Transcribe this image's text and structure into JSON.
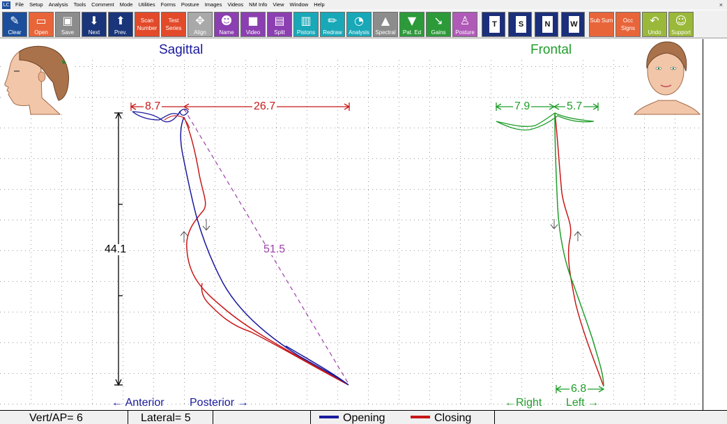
{
  "menu": {
    "items": [
      "File",
      "Setup",
      "Analysis",
      "Tools",
      "Comment",
      "Mode",
      "Utilities",
      "Forms",
      "Posture",
      "Images",
      "Videos",
      "NM Info",
      "View",
      "Window",
      "Help"
    ],
    "app_icon": "LC",
    "close_glyph": "×"
  },
  "toolbar": {
    "buttons": [
      {
        "label": "Clear",
        "icon": "clear-icon",
        "glyph": "✎",
        "color": "#1b4f9c"
      },
      {
        "label": "Open",
        "icon": "folder-icon",
        "glyph": "▭",
        "color": "#e8653a"
      },
      {
        "label": "Save",
        "icon": "save-icon",
        "glyph": "▣",
        "color": "#8c8c8c"
      },
      {
        "label": "Next",
        "icon": "arrow-down-icon",
        "glyph": "⬇",
        "color": "#1a3579"
      },
      {
        "label": "Prev.",
        "icon": "arrow-up-icon",
        "glyph": "⬆",
        "color": "#1a3579"
      },
      {
        "label": "Scan Number",
        "icon": "",
        "glyph": "",
        "color": "#e24a2a"
      },
      {
        "label": "Test Series",
        "icon": "",
        "glyph": "",
        "color": "#e24a2a"
      },
      {
        "label": "Align",
        "icon": "align-icon",
        "glyph": "✥",
        "color": "#a9a9a9"
      },
      {
        "label": "Name",
        "icon": "people-icon",
        "glyph": "☻",
        "color": "#8b3fb0"
      },
      {
        "label": "Video",
        "icon": "camera-icon",
        "glyph": "■",
        "color": "#8b3fb0"
      },
      {
        "label": "Split",
        "icon": "split-icon",
        "glyph": "▤",
        "color": "#8b3fb0"
      },
      {
        "label": "Pistons",
        "icon": "bars-icon",
        "glyph": "▥",
        "color": "#18a8b8"
      },
      {
        "label": "Redraw",
        "icon": "pencil-icon",
        "glyph": "✏",
        "color": "#18a8b8"
      },
      {
        "label": "Analysis",
        "icon": "chart-icon",
        "glyph": "◔",
        "color": "#18a8b8"
      },
      {
        "label": "Spectral",
        "icon": "spectrum-icon",
        "glyph": "▲",
        "color": "#8c8c8c"
      },
      {
        "label": "Pat. Ed",
        "icon": "graduation-cap-icon",
        "glyph": "▼",
        "color": "#2d9a3a"
      },
      {
        "label": "Gains",
        "icon": "gains-icon",
        "glyph": "↘",
        "color": "#2d9a3a"
      },
      {
        "label": "Posture",
        "icon": "person-icon",
        "glyph": "♙",
        "color": "#b05ab8"
      }
    ],
    "doc_buttons": [
      {
        "letter": "T",
        "icon": "document-t-icon"
      },
      {
        "letter": "S",
        "icon": "document-s-icon"
      },
      {
        "letter": "N",
        "icon": "document-n-icon"
      },
      {
        "letter": "W",
        "icon": "document-w-icon"
      }
    ],
    "right_buttons": [
      {
        "label": "Sub Sum",
        "icon": "",
        "glyph": "",
        "color": "#e8653a"
      },
      {
        "label": "Occ Signs",
        "icon": "",
        "glyph": "",
        "color": "#e8653a"
      },
      {
        "label": "Undo",
        "icon": "undo-icon",
        "glyph": "↶",
        "color": "#9ab83a"
      },
      {
        "label": "Support",
        "icon": "support-person-icon",
        "glyph": "☺",
        "color": "#9ab83a"
      }
    ]
  },
  "sagittal": {
    "title": "Sagittal",
    "anterior_dim": "8.7",
    "posterior_dim": "26.7",
    "vertical_dim": "44.1",
    "diagonal_dim": "51.5",
    "anterior_label": "← Anterior",
    "posterior_label": "Posterior →"
  },
  "frontal": {
    "title": "Frontal",
    "right_dim": "7.9",
    "left_dim": "5.7",
    "bottom_dim": "6.8",
    "right_label": "←Right",
    "left_label": "Left →"
  },
  "status": {
    "vert_ap": "Vert/AP= 6",
    "lateral": "Lateral= 5",
    "opening_label": "Opening",
    "closing_label": "Closing",
    "opening_color": "#1a1a9e",
    "closing_color": "#c81818"
  },
  "colors": {
    "sagittal_title": "#1a1a9e",
    "frontal_title": "#1f9e2a",
    "dimension_red": "#c81818",
    "diagonal_purple": "#9a3fa8",
    "frontal_dims": "#1f9e2a"
  },
  "icons": {
    "profile_face": "profile-face-icon",
    "frontal_face": "frontal-face-icon",
    "opening_arrow": "arrow-up-icon",
    "closing_arrow": "arrow-down-icon"
  }
}
